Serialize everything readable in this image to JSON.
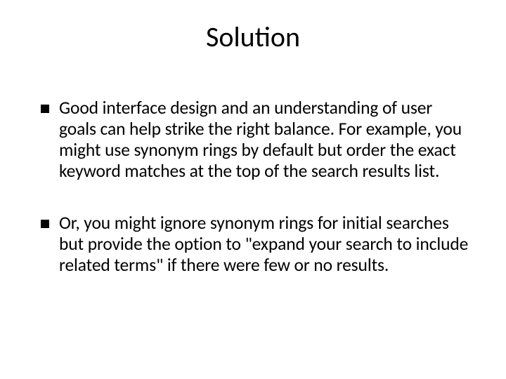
{
  "slide": {
    "title": "Solution",
    "bullets": [
      {
        "text": "Good interface design and an understanding of user goals can help strike the right balance.  For example, you might use synonym rings by default but order the exact keyword matches at the top of the search results list."
      },
      {
        "text": "Or, you might ignore synonym rings for initial searches but provide the option to \"expand your search to include related terms\" if there were few or no results."
      }
    ]
  }
}
